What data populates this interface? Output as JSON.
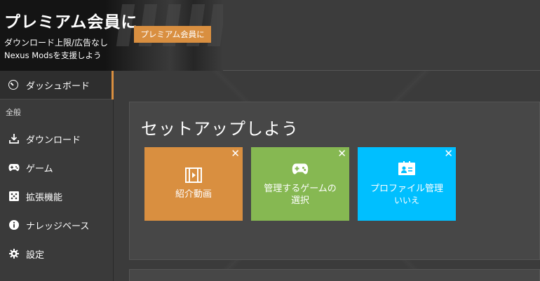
{
  "banner": {
    "title": "プレミアム会員に",
    "line1": "ダウンロード上限/広告なし",
    "line2": "Nexus Modsを支援しよう",
    "cta": "プレミアム会員に"
  },
  "sidebar": {
    "dashboard": "ダッシュボード",
    "section": "全般",
    "items": [
      {
        "label": "ダウンロード",
        "icon": "download-icon"
      },
      {
        "label": "ゲーム",
        "icon": "gamepad-icon"
      },
      {
        "label": "拡張機能",
        "icon": "extensions-icon"
      },
      {
        "label": "ナレッジベース",
        "icon": "info-icon"
      },
      {
        "label": "設定",
        "icon": "gear-icon"
      }
    ]
  },
  "main": {
    "title": "セットアップしよう",
    "cards": [
      {
        "label": "紹介動画",
        "icon": "film-icon",
        "color": "#d98f40"
      },
      {
        "label": "管理するゲームの選択",
        "label_line1": "管理するゲームの",
        "label_line2": "選択",
        "icon": "gamepad-icon",
        "color": "#86b852"
      },
      {
        "label": "プロファイル管理",
        "sub": "いいえ",
        "icon": "profile-card-icon",
        "color": "#00bfff"
      }
    ]
  }
}
